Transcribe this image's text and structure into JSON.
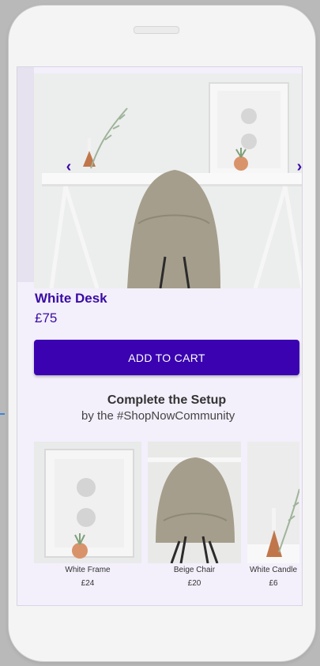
{
  "product": {
    "title": "White Desk",
    "price": "£75"
  },
  "carousel": {
    "prev_icon": "chevron-left-icon",
    "next_icon": "chevron-right-icon"
  },
  "cart": {
    "button_label": "ADD TO CART"
  },
  "community": {
    "title": "Complete the Setup",
    "subtitle": "by the #ShopNowCommunity",
    "items": [
      {
        "name": "White Frame",
        "price": "£24"
      },
      {
        "name": "Beige Chair",
        "price": "£20"
      },
      {
        "name": "White Candle",
        "price": "£6"
      }
    ]
  },
  "colors": {
    "accent": "#3a02b0",
    "title": "#3a0ca3",
    "screen_bg": "#f3effb",
    "annotation_dash": "#3b86d9"
  }
}
